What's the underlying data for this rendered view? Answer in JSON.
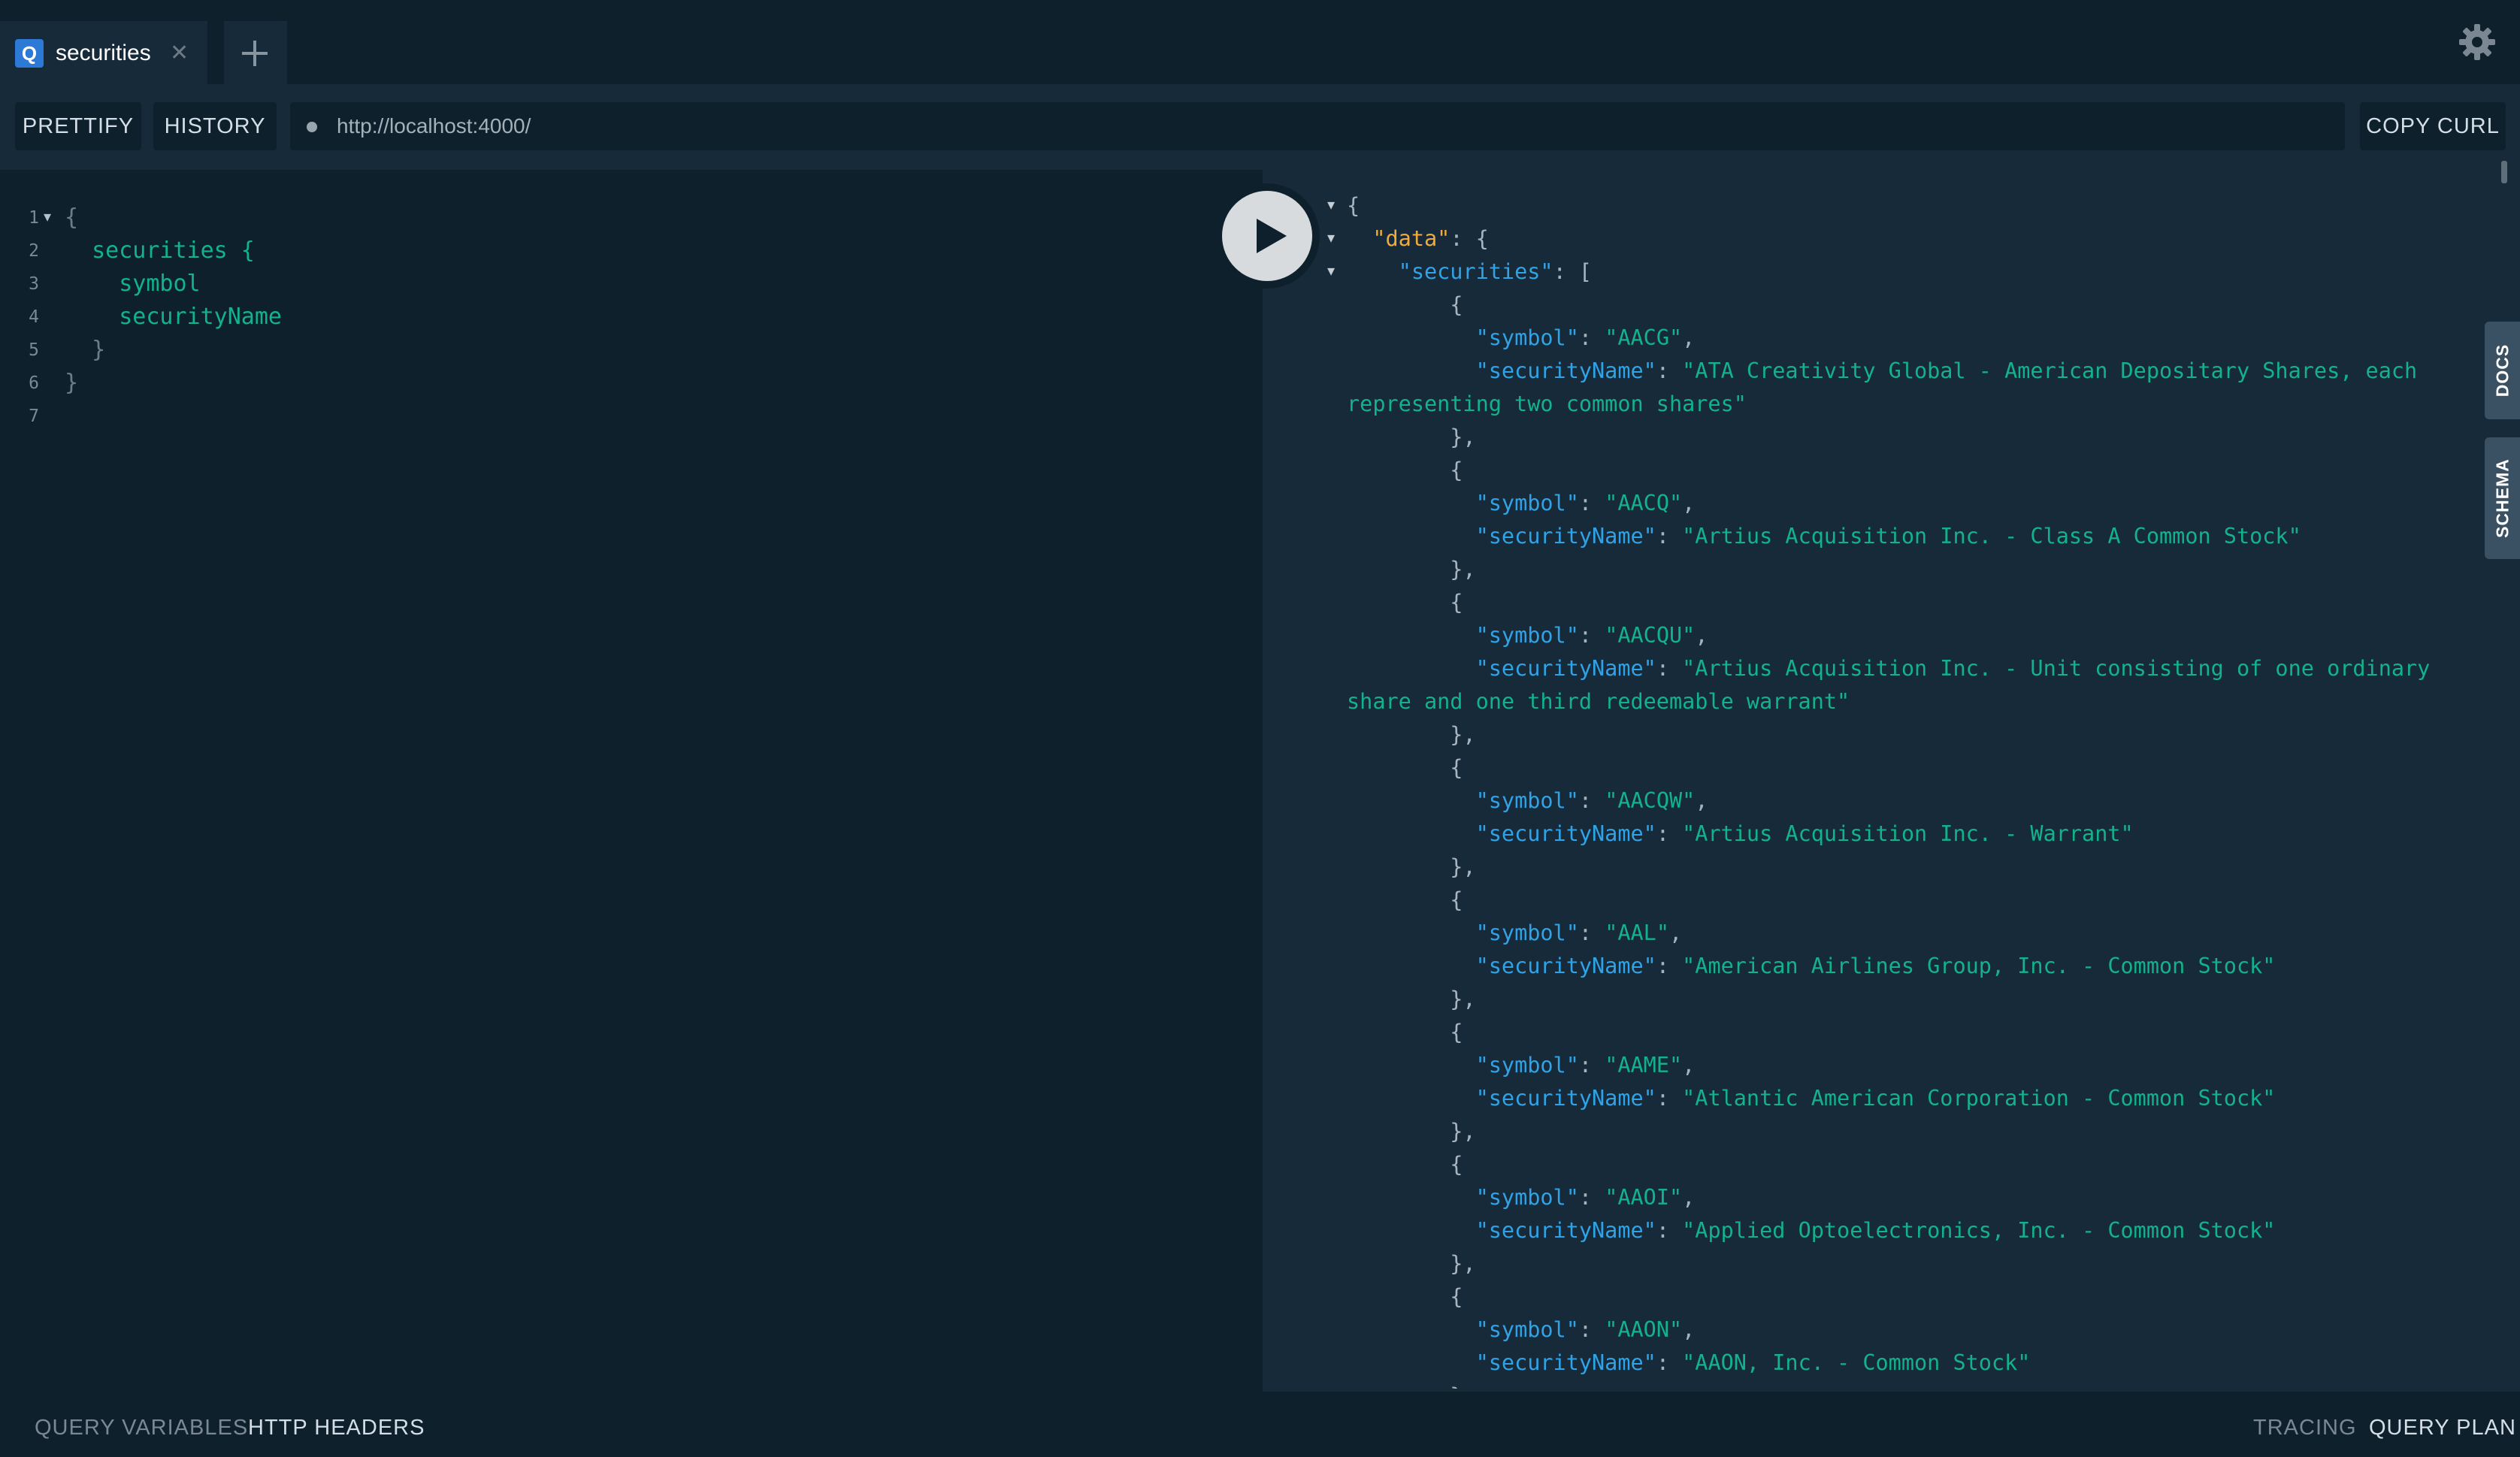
{
  "tab": {
    "icon_letter": "Q",
    "title": "securities"
  },
  "toolbar": {
    "prettify_label": "PRETTIFY",
    "history_label": "HISTORY",
    "url": "http://localhost:4000/",
    "copy_curl_label": "COPY CURL"
  },
  "editor": {
    "lines": [
      {
        "num": "1",
        "text": "{"
      },
      {
        "num": "2",
        "text": "  securities {"
      },
      {
        "num": "3",
        "text": "    symbol"
      },
      {
        "num": "4",
        "text": "    securityName"
      },
      {
        "num": "5",
        "text": "  }"
      },
      {
        "num": "6",
        "text": "}"
      },
      {
        "num": "7",
        "text": ""
      }
    ]
  },
  "result": {
    "data_key": "data",
    "securities_key": "securities",
    "securities": [
      {
        "symbol": "AACG",
        "name_line1": "ATA Creativity Global - American Depositary Shares, each",
        "name_line2": "representing two common shares"
      },
      {
        "symbol": "AACQ",
        "name_line1": "Artius Acquisition Inc. - Class A Common Stock"
      },
      {
        "symbol": "AACQU",
        "name_line1": "Artius Acquisition Inc. - Unit consisting of one ordinary",
        "name_line2": "share and one third redeemable warrant"
      },
      {
        "symbol": "AACQW",
        "name_line1": "Artius Acquisition Inc. - Warrant"
      },
      {
        "symbol": "AAL",
        "name_line1": "American Airlines Group, Inc. - Common Stock"
      },
      {
        "symbol": "AAME",
        "name_line1": "Atlantic American Corporation - Common Stock"
      },
      {
        "symbol": "AAOI",
        "name_line1": "Applied Optoelectronics, Inc. - Common Stock"
      },
      {
        "symbol": "AAON",
        "name_line1": "AAON, Inc. - Common Stock"
      }
    ]
  },
  "side_tabs": {
    "docs": "DOCS",
    "schema": "SCHEMA"
  },
  "bottom": {
    "query_variables": "QUERY VARIABLES",
    "http_headers": "HTTP HEADERS",
    "tracing": "TRACING",
    "query_plan": "QUERY PLAN"
  },
  "icons": {
    "settings": "gear-icon",
    "play": "play-icon",
    "new_tab": "plus-icon",
    "close": "close-icon"
  },
  "colors": {
    "background": "#172a3a",
    "panel": "#0f202d",
    "key": "#2fa3e6",
    "string": "#13b28c",
    "data_key": "#f0ab3c",
    "accent": "#2d7ad6"
  }
}
